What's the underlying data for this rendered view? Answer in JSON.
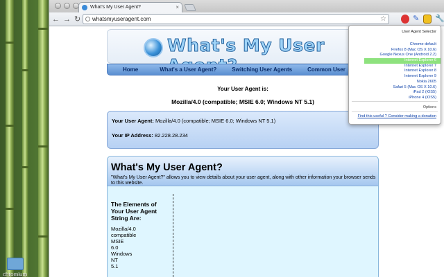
{
  "browser": {
    "tab_title": "What's My User Agent?",
    "tab_close": "×",
    "url": "whatsmyuseragent.com",
    "back": "←",
    "forward": "→",
    "reload": "↻",
    "star": "☆",
    "wrench": "🔧"
  },
  "desktop": {
    "folder_label": "chromium"
  },
  "site": {
    "logo_text": "What's My User Agent?",
    "nav": [
      "Home",
      "What's a User Agent?",
      "Switching User Agents",
      "Common User"
    ],
    "ua_label": "Your User Agent is:",
    "ua_value": "Mozilla/4.0 (compatible; MSIE 6.0; Windows NT 5.1)",
    "info": {
      "ua_key": "Your User Agent:",
      "ua_val": "Mozilla/4.0 (compatible; MSIE 6.0; Windows NT 5.1)",
      "ip_key": "Your IP Address:",
      "ip_val": "82.228.28.234"
    },
    "main_title": "What's My User Agent?",
    "main_desc": "\"What's My User Agent?\" allows you to view details about your user agent, along with other information your browser sends to this website.",
    "elements_heading": "The Elements of Your User Agent String Are:",
    "elements": [
      "Mozilla/4.0",
      "compatible",
      "MSIE",
      "6.0",
      "Windows",
      "NT",
      "5.1"
    ]
  },
  "popup": {
    "title": "User Agent Selector",
    "items": [
      "Chrome default",
      "Firefox 8 (Mac OS X 10.6)",
      "Google Nexus One (Android 2.2)",
      "Internet Explorer 6",
      "Internet Explorer 7",
      "Internet Explorer 8",
      "Internet Explorer 9",
      "Nokia 2605",
      "Safari 5 (Mac OS X 10.6)",
      "iPad 2 (iOS5)",
      "iPhone 4 (iOS5)"
    ],
    "selected_index": 3,
    "options": "Options",
    "footer": "Find this useful ? Consider making a donation"
  },
  "colors": {
    "selected_item": "#8ee27e",
    "nav_bg": "#5b8fd1",
    "main_bg": "#dff6ff"
  }
}
